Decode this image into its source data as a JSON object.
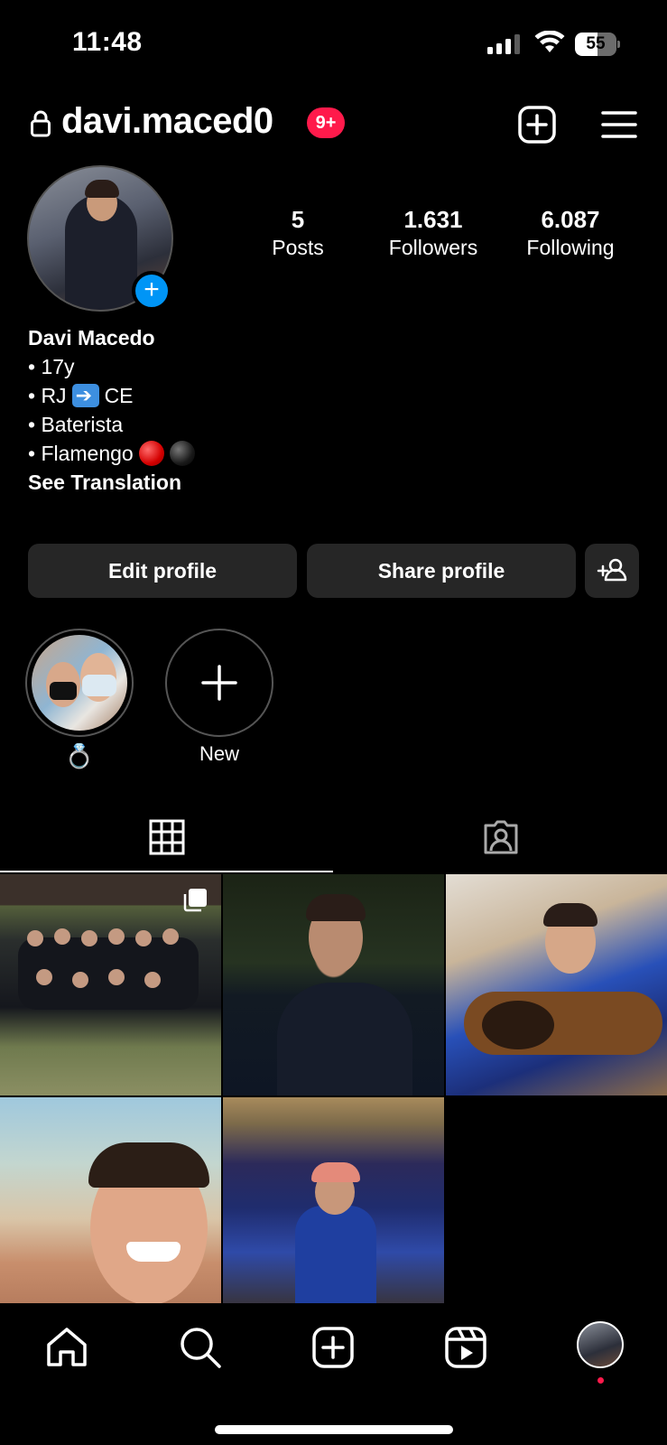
{
  "status_bar": {
    "time": "11:48",
    "battery_level": "55",
    "battery_fraction": 0.55,
    "icons": [
      "signal-icon",
      "wifi-icon",
      "battery-icon"
    ]
  },
  "header": {
    "username": "davi.maced0",
    "notification_badge": "9+",
    "badge_color": "#ff1a4b",
    "icons": [
      "lock-icon",
      "create-post-icon",
      "menu-icon"
    ]
  },
  "profile": {
    "stats": [
      {
        "value": "5",
        "label": "Posts"
      },
      {
        "value": "1.631",
        "label": "Followers"
      },
      {
        "value": "6.087",
        "label": "Following"
      }
    ],
    "bio": {
      "name": "Davi Macedo",
      "line1": "• 17y",
      "line2_a": "• RJ",
      "line2_b": "CE",
      "line3": "• Baterista",
      "line4": "• Flamengo",
      "see_translation": "See Translation"
    },
    "add_story_accent": "#0095f6"
  },
  "actions": {
    "edit_profile": "Edit profile",
    "share_profile": "Share profile",
    "discover_icon": "add-person-icon"
  },
  "highlights": [
    {
      "label": "💍",
      "type": "story"
    },
    {
      "label": "New",
      "type": "new"
    }
  ],
  "tabs": [
    {
      "name": "posts-grid",
      "icon": "grid-icon",
      "active": true
    },
    {
      "name": "tagged",
      "icon": "tagged-person-icon",
      "active": false
    }
  ],
  "posts": [
    {
      "id": "post-1",
      "description": "team photo",
      "multi": true
    },
    {
      "id": "post-2",
      "description": "portrait night"
    },
    {
      "id": "post-3",
      "description": "playing guitar"
    },
    {
      "id": "post-4",
      "description": "beach selfie"
    },
    {
      "id": "post-5",
      "description": "lake night"
    }
  ],
  "bottom_nav": {
    "items": [
      "home-icon",
      "search-icon",
      "create-icon",
      "reels-icon",
      "profile-avatar"
    ]
  }
}
